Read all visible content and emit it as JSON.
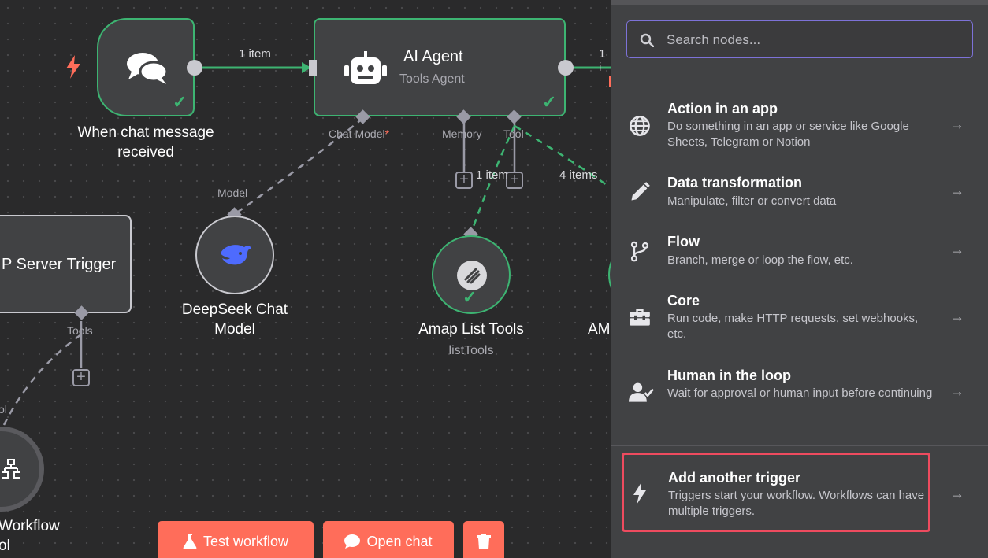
{
  "canvas": {
    "trigger_node": {
      "title_line1": "When chat message",
      "title_line2": "received"
    },
    "agent_node": {
      "title": "AI Agent",
      "subtitle": "Tools Agent",
      "port_chat_model": "Chat Model",
      "port_required": "*",
      "port_memory": "Memory",
      "port_tool": "Tool"
    },
    "edge_labels": {
      "trigger_to_agent": "1 item",
      "agent_out": "1 i",
      "tool_1": "1 item",
      "tool_2": "4 items"
    },
    "server_trigger_node": {
      "title": "P Server Trigger",
      "port_tools": "Tools"
    },
    "deepseek_node": {
      "title_line1": "DeepSeek Chat",
      "title_line2": "Model",
      "port_model": "Model"
    },
    "amap_node": {
      "title": "Amap List Tools",
      "subtitle": "listTools"
    },
    "partial_node": {
      "title": "AM"
    },
    "workflow_tool_node": {
      "port_label": "ol",
      "title_line1": "Workflow",
      "title_line2": "ol"
    }
  },
  "toolbar": {
    "test_workflow_label": "Test workflow",
    "open_chat_label": "Open chat"
  },
  "panel": {
    "search": {
      "placeholder": "Search nodes..."
    },
    "items": [
      {
        "title": "Action in an app",
        "desc": "Do something in an app or service like Google Sheets, Telegram or Notion",
        "icon": "globe-icon"
      },
      {
        "title": "Data transformation",
        "desc": "Manipulate, filter or convert data",
        "icon": "pen-icon"
      },
      {
        "title": "Flow",
        "desc": "Branch, merge or loop the flow, etc.",
        "icon": "branch-icon"
      },
      {
        "title": "Core",
        "desc": "Run code, make HTTP requests, set webhooks, etc.",
        "icon": "toolbox-icon"
      },
      {
        "title": "Human in the loop",
        "desc": "Wait for approval or human input before continuing",
        "icon": "user-check-icon"
      },
      {
        "title": "Add another trigger",
        "desc": "Triggers start your workflow. Workflows can have multiple triggers.",
        "icon": "bolt-icon"
      }
    ]
  },
  "colors": {
    "accent_green": "#3db472",
    "accent_orange": "#ff6d5a",
    "highlight_red": "#ee4b5f",
    "search_border": "#7d72d8"
  }
}
